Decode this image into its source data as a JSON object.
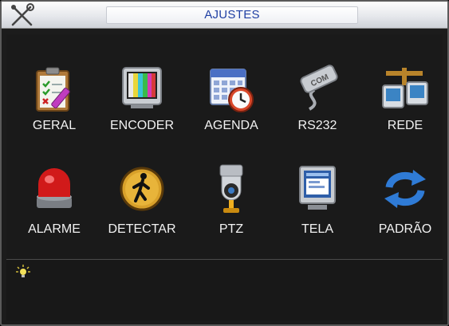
{
  "window": {
    "title": "AJUSTES"
  },
  "menu": {
    "items": [
      {
        "label": "GERAL",
        "icon": "clipboard-checklist-icon"
      },
      {
        "label": "ENCODER",
        "icon": "tv-monitor-icon"
      },
      {
        "label": "AGENDA",
        "icon": "calendar-clock-icon"
      },
      {
        "label": "RS232",
        "icon": "com-port-cable-icon"
      },
      {
        "label": "REDE",
        "icon": "network-computers-icon"
      },
      {
        "label": "ALARME",
        "icon": "red-alarm-light-icon"
      },
      {
        "label": "DETECTAR",
        "icon": "walking-person-sign-icon"
      },
      {
        "label": "PTZ",
        "icon": "ptz-camera-icon"
      },
      {
        "label": "TELA",
        "icon": "display-screen-icon"
      },
      {
        "label": "PADRÃO",
        "icon": "refresh-arrows-icon"
      }
    ]
  },
  "status": {
    "text": "",
    "icon": "lightbulb-hint-icon"
  },
  "colors": {
    "title_text": "#1f3fa3",
    "background": "#1c1c1c",
    "label_text": "#f2f2f2"
  }
}
